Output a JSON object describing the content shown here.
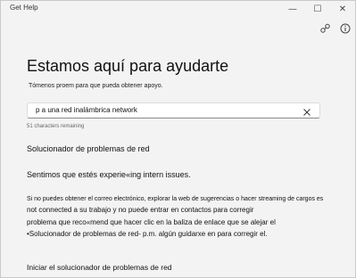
{
  "window": {
    "title": "Get Help",
    "controls": {
      "minimize": "—",
      "maximize": "☐",
      "close": "✕"
    }
  },
  "header": {
    "title": "Estamos aquí para ayudarte",
    "subtitle": "Tómenos proem para que pueda obtener apoyo."
  },
  "search": {
    "value": "p a una red inalámbrica  network",
    "clear_icon": "close-icon",
    "chars_remaining": "51 characters remaining"
  },
  "result": {
    "heading": "Solucionador de problemas de red",
    "intro": "Sentimos que estés experie«ing intern issues.",
    "lines": [
      "Si no puedes obtener el correo electrónico, explorar la web de sugerencias o hacer streaming de cargos es",
      "not connected    a su trabajo y no puede entrar en contactos para corregir",
      "problema que reco«mend que hacer clic en la baliza de enlace que se alejar el",
      "•Solucionador de problemas de red- p.m. algún guidarxe en para corregir el."
    ],
    "link": "Iniciar el solucionador de problemas de red"
  },
  "icons": {
    "share": "share-icon",
    "info": "info-icon"
  }
}
